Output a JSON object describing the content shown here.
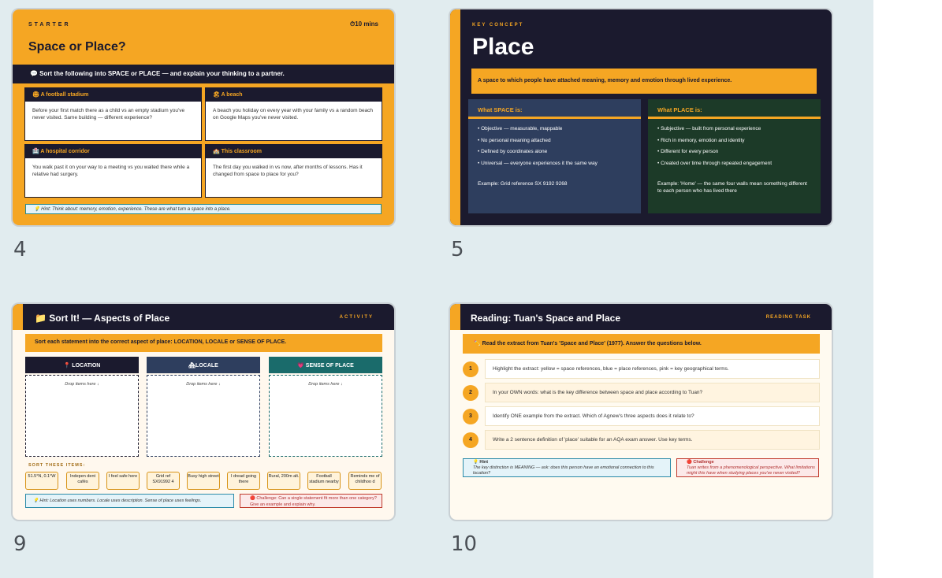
{
  "slides": [
    {
      "number": "4",
      "label": "STARTER",
      "time": "⏱10 mins",
      "title": "Space or Place?",
      "banner": "💬 Sort the following into SPACE or PLACE — and explain your thinking to a partner.",
      "cards": [
        {
          "title": "🏟 A football stadium",
          "body": "Before your first match there as a child vs an empty stadium you've never visited. Same building — different experience?"
        },
        {
          "title": "🏖 A beach",
          "body": "A beach you holiday on every year with your family vs a random beach on Google Maps you've never visited."
        },
        {
          "title": "🏥 A hospital corridor",
          "body": "You walk past it on your way to a meeting vs you waited there while a relative had surgery."
        },
        {
          "title": "🏫 This classroom",
          "body": "The first day you walked in vs now, after months of lessons. Has it changed from space to place for you?"
        }
      ],
      "hint": "💡 Hint: Think about: memory, emotion, experience. These are what turn a space into a place."
    },
    {
      "number": "5",
      "label": "KEY CONCEPT",
      "title": "Place",
      "definition": "A space to which people have attached meaning, memory and emotion through lived experience.",
      "space": {
        "heading": "What SPACE is:",
        "items": [
          "• Objective — measurable, mappable",
          "• No personal meaning attached",
          "• Defined by coordinates alone",
          "• Universal — everyone experiences it the same way"
        ],
        "example": "Example: Grid reference SX 9192 9268"
      },
      "place": {
        "heading": "What PLACE is:",
        "items": [
          "• Subjective — built from personal experience",
          "• Rich in memory, emotion and identity",
          "• Different for every person",
          "• Created over time through repeated engagement"
        ],
        "example": "Example: 'Home' — the same four walls mean something different to each person who has lived there"
      }
    },
    {
      "number": "9",
      "title": "📁 Sort It! — Aspects of Place",
      "label": "ACTIVITY",
      "instruction": "Sort each statement into the correct aspect of place: LOCATION, LOCALE or SENSE OF PLACE.",
      "bins": [
        {
          "title": "📍 LOCATION",
          "drop": "Drop items here ↓",
          "color": "#1b1a2e"
        },
        {
          "title": "🏘LOCALE",
          "drop": "Drop items here ↓",
          "color": "#2e3e5e"
        },
        {
          "title": "💗 SENSE OF PLACE",
          "drop": "Drop items here ↓",
          "color": "#1a6b6b"
        }
      ],
      "items_label": "SORT THESE ITEMS:",
      "items": [
        "51.5°N, 0.1°W",
        "Indepen dent cafés",
        "I feel safe here",
        "Grid ref SX91992 4",
        "Busy high street",
        "I dread going there",
        "Rural, 200m alt.",
        "Football stadium nearby",
        "Reminds me of childhoo d"
      ],
      "hint": "💡 Hint: Location uses numbers. Locale uses description. Sense of place uses feelings.",
      "challenge": "🔴 Challenge: Can a single statement fit more than one category? Give an example and explain why."
    },
    {
      "number": "10",
      "title": "Reading: Tuan's Space and Place",
      "label": "READING TASK",
      "instruction": "✏️ Read the extract from Tuan's 'Space and Place' (1977). Answer the questions below.",
      "questions": [
        {
          "n": "1",
          "text": "Highlight the extract: yellow = space references, blue = place references, pink = key geographical terms."
        },
        {
          "n": "2",
          "text": "In your OWN words: what is the key difference between space and place according to Tuan?"
        },
        {
          "n": "3",
          "text": "Identify ONE example from the extract. Which of Agnew's three aspects does it relate to?"
        },
        {
          "n": "4",
          "text": "Write a 2 sentence definition of 'place' suitable for an AQA exam answer. Use key terms."
        }
      ],
      "hint_label": "💡 Hint",
      "hint": "The key distinction is MEANING — ask: does this person have an emotional connection to this location?",
      "challenge_label": "🔴 Challenge",
      "challenge": "Tuan writes from a phenomenological perspective. What limitations might this have when studying places you've never visited?"
    }
  ]
}
